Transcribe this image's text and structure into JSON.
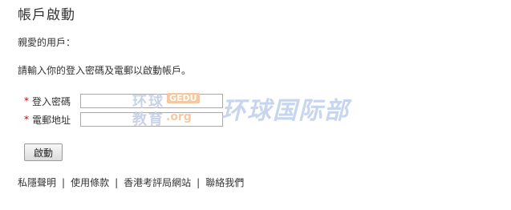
{
  "page": {
    "title": "帳戶啟動",
    "greeting": "親愛的用戶：",
    "instruction": "請輸入你的登入密碼及電郵以啟動帳戶。"
  },
  "form": {
    "required_mark": "*",
    "password_label": "登入密碼",
    "password_value": "",
    "email_label": "電郵地址",
    "email_value": "",
    "submit_label": "啟動"
  },
  "footer": {
    "links": [
      "私隱聲明",
      "使用條款",
      "香港考評局網站",
      "聯絡我們"
    ],
    "separator": "|"
  },
  "watermark": {
    "huanqiu": "环球",
    "gedu": "GEDU",
    "jiaoyu": "教育",
    "org": ".org",
    "brand": "环球国际部"
  }
}
